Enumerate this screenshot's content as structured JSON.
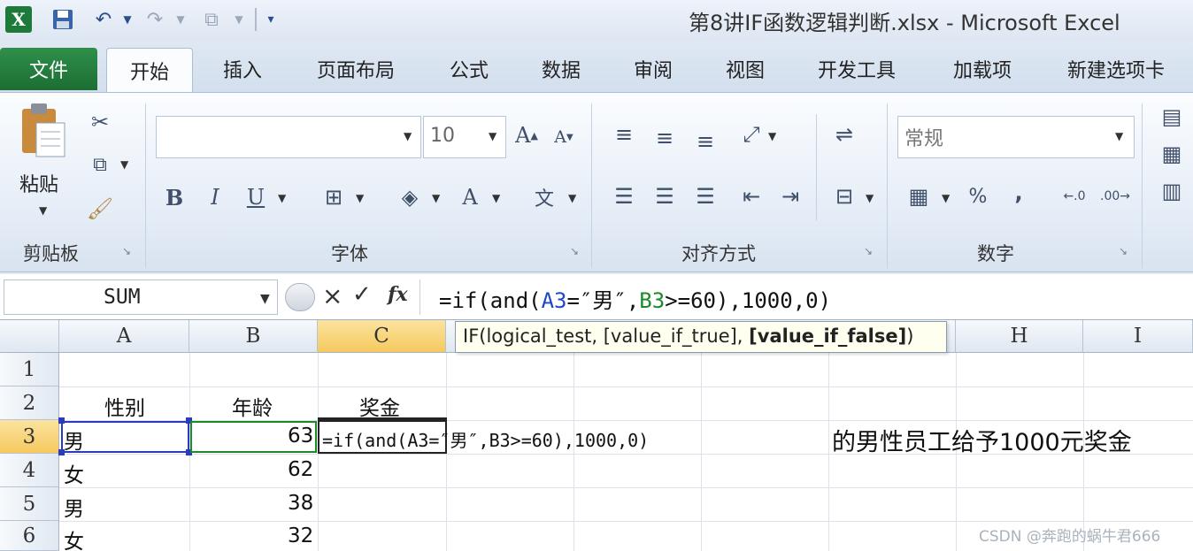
{
  "window": {
    "title": "第8讲IF函数逻辑判断.xlsx  -  Microsoft Excel"
  },
  "tabs": [
    "文件",
    "开始",
    "插入",
    "页面布局",
    "公式",
    "数据",
    "审阅",
    "视图",
    "开发工具",
    "加载项",
    "新建选项卡"
  ],
  "ribbon": {
    "clipboard": {
      "paste_label": "粘贴",
      "group_label": "剪贴板"
    },
    "font": {
      "font_size": "10",
      "group_label": "字体",
      "bold": "B",
      "italic": "I",
      "underline": "U"
    },
    "alignment": {
      "group_label": "对齐方式"
    },
    "number": {
      "format": "常规",
      "group_label": "数字",
      "percent": "%",
      "comma": ","
    }
  },
  "formula_bar": {
    "name_box": "SUM",
    "formula": "=if(and(A3=″男″,B3>=60),1000,0)",
    "cancel": "×",
    "enter": "✓",
    "fx": "fx"
  },
  "tooltip": {
    "prefix": "IF(logical_test, [value_if_true], ",
    "bold_arg": "[value_if_false]",
    "suffix": ")"
  },
  "columns": [
    "A",
    "B",
    "C",
    "H",
    "I"
  ],
  "rows": [
    {
      "num": "1",
      "a": "",
      "b": "",
      "c": ""
    },
    {
      "num": "2",
      "a": "性别",
      "b": "年龄",
      "c": "奖金"
    },
    {
      "num": "3",
      "a": "男",
      "b": "63",
      "c": "=if(and(A3=″男″,B3>=60),1000,0)"
    },
    {
      "num": "4",
      "a": "女",
      "b": "62",
      "c": ""
    },
    {
      "num": "5",
      "a": "男",
      "b": "38",
      "c": ""
    },
    {
      "num": "6",
      "a": "女",
      "b": "32",
      "c": ""
    }
  ],
  "note": "的男性员工给予1000元奖金",
  "watermark": "CSDN @奔跑的蜗牛君666"
}
